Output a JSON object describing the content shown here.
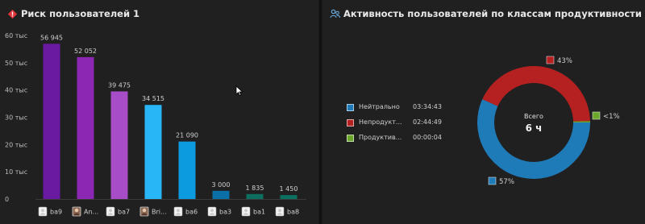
{
  "left_panel": {
    "title": "Риск пользователей 1",
    "icon": "diamond-risk-icon",
    "chart_data": {
      "type": "bar",
      "categories": [
        "ba9",
        "An...",
        "ba7",
        "Bri...",
        "ba6",
        "ba3",
        "ba1",
        "ba8"
      ],
      "values": [
        56945,
        52052,
        39475,
        34515,
        21090,
        3000,
        1835,
        1450
      ],
      "value_labels": [
        "56 945",
        "52 052",
        "39 475",
        "34 515",
        "21 090",
        "3 000",
        "1 835",
        "1 450"
      ],
      "bar_colors": [
        "#6a1aa0",
        "#8b27b3",
        "#a74dc7",
        "#29b6f6",
        "#0d9be0",
        "#0b6fa8",
        "#0b6e5e",
        "#0b7060"
      ],
      "category_icons": [
        "user-icon",
        "avatar-photo-icon",
        "user-icon",
        "avatar-photo-icon",
        "user-icon",
        "user-icon",
        "user-icon",
        "user-icon"
      ],
      "y_ticks": [
        "0",
        "10 тыс",
        "20 тыс",
        "30 тыс",
        "40 тыс",
        "50 тыс",
        "60 тыс"
      ],
      "ylim": [
        0,
        60000
      ],
      "grid": false
    }
  },
  "right_panel": {
    "title": "Активность пользователей по классам продуктивности",
    "icon": "users-activity-icon",
    "chart_data": {
      "type": "pie",
      "style": "donut",
      "center_label": "Всего",
      "center_value": "6 ч",
      "slices": [
        {
          "name": "Нейтрально",
          "duration": "03:34:43",
          "value": 57,
          "label": "57%",
          "color": "#1f7ab8"
        },
        {
          "name": "Непродукт...",
          "duration": "02:44:49",
          "value": 43,
          "label": "43%",
          "color": "#b52020"
        },
        {
          "name": "Продуктив...",
          "duration": "00:00:04",
          "value": 0.4,
          "label": "<1%",
          "color": "#6aa62a"
        }
      ]
    }
  }
}
